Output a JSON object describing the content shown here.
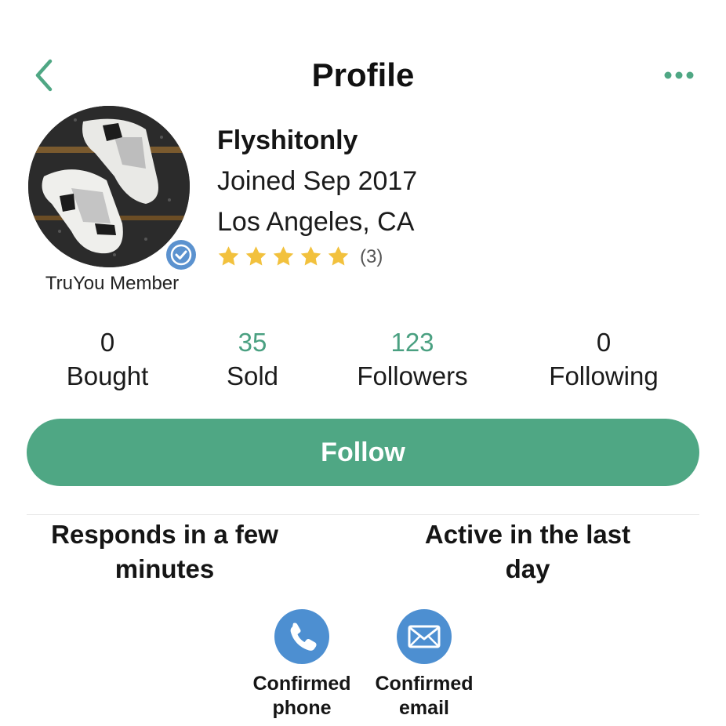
{
  "header": {
    "title": "Profile",
    "back_icon": "chevron-left-icon",
    "more_icon": "more-dots-icon",
    "accent_color": "#4fa784"
  },
  "profile": {
    "username": "Flyshitonly",
    "joined": "Joined Sep 2017",
    "location": "Los Angeles, CA",
    "rating": 5,
    "rating_count": "(3)",
    "member_label": "TruYou Member",
    "verified_icon": "verified-check-icon"
  },
  "stats": [
    {
      "value": "0",
      "label": "Bought"
    },
    {
      "value": "35",
      "label": "Sold"
    },
    {
      "value": "123",
      "label": "Followers"
    },
    {
      "value": "0",
      "label": "Following"
    }
  ],
  "follow_button": {
    "label": "Follow"
  },
  "activity": {
    "responds_line1": "Responds in a few",
    "responds_line2": "minutes",
    "active_line1": "Active in the last",
    "active_line2": "day"
  },
  "confirmations": [
    {
      "icon": "phone-icon",
      "line1": "Confirmed",
      "line2": "phone",
      "color": "#4d8fd1"
    },
    {
      "icon": "email-icon",
      "line1": "Confirmed",
      "line2": "email",
      "color": "#4d8fd1"
    }
  ]
}
